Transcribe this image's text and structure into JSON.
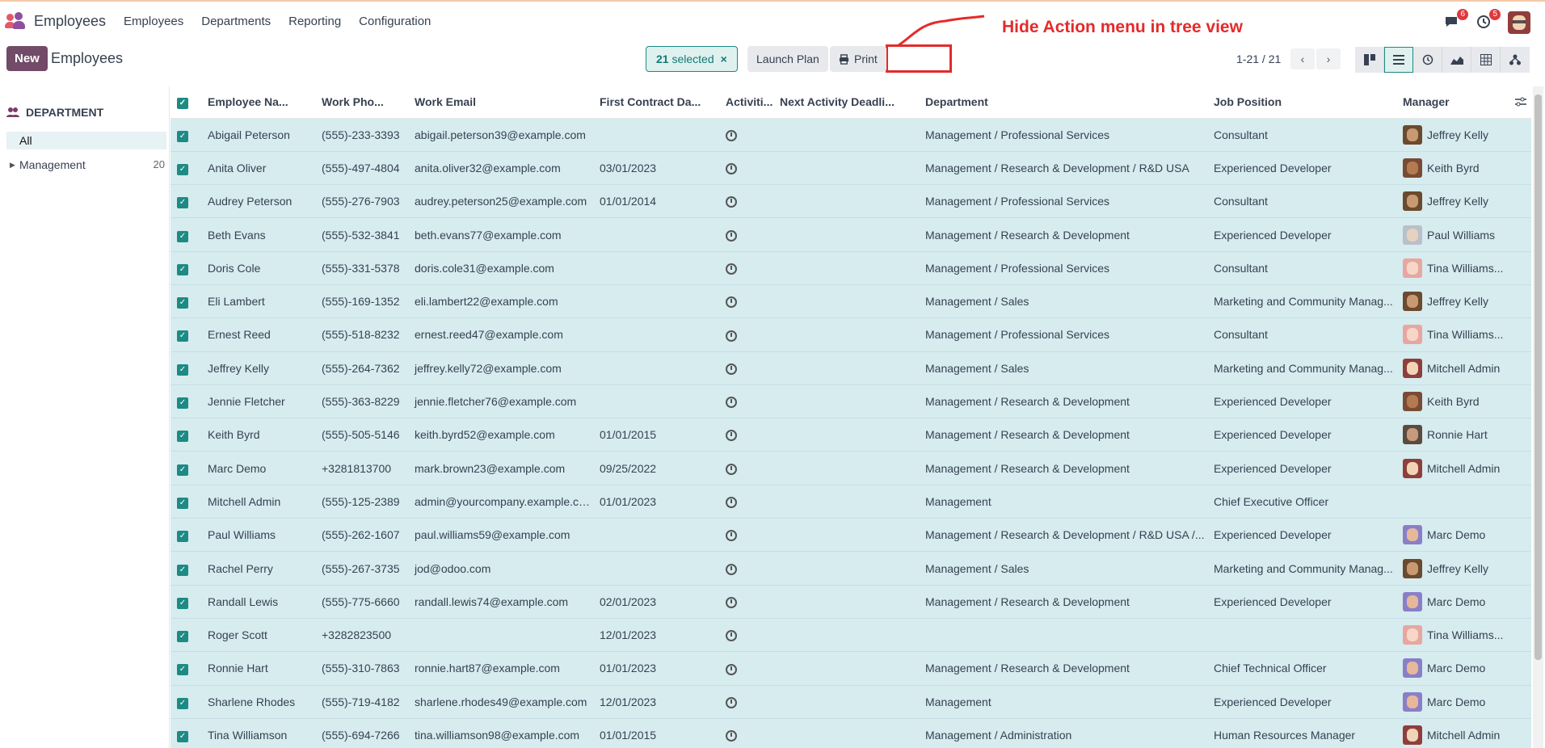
{
  "app": {
    "name": "Employees",
    "menu": [
      "Employees",
      "Departments",
      "Reporting",
      "Configuration"
    ]
  },
  "systray": {
    "messages_count": "6",
    "activities_count": "5"
  },
  "annotation": {
    "text": "Hide Action menu in tree view"
  },
  "control": {
    "new_label": "New",
    "breadcrumb": "Employees",
    "selected_count": "21",
    "selected_label": "selected",
    "launch_plan_label": "Launch Plan",
    "print_label": "Print",
    "pager": "1-21 / 21"
  },
  "sidebar": {
    "title": "DEPARTMENT",
    "all_label": "All",
    "items": [
      {
        "label": "Management",
        "count": "20"
      }
    ]
  },
  "columns": [
    "Employee Na...",
    "Work Pho...",
    "Work Email",
    "First Contract Da...",
    "Activiti...",
    "Next Activity Deadli...",
    "Department",
    "Job Position",
    "Manager"
  ],
  "rows": [
    {
      "name": "Abigail Peterson",
      "phone": "(555)-233-3393",
      "email": "abigail.peterson39@example.com",
      "contract": "",
      "dept": "Management / Professional Services",
      "job": "Consultant",
      "manager": "Jeffrey Kelly"
    },
    {
      "name": "Anita Oliver",
      "phone": "(555)-497-4804",
      "email": "anita.oliver32@example.com",
      "contract": "03/01/2023",
      "dept": "Management / Research & Development / R&D USA",
      "job": "Experienced Developer",
      "manager": "Keith Byrd"
    },
    {
      "name": "Audrey Peterson",
      "phone": "(555)-276-7903",
      "email": "audrey.peterson25@example.com",
      "contract": "01/01/2014",
      "dept": "Management / Professional Services",
      "job": "Consultant",
      "manager": "Jeffrey Kelly"
    },
    {
      "name": "Beth Evans",
      "phone": "(555)-532-3841",
      "email": "beth.evans77@example.com",
      "contract": "",
      "dept": "Management / Research & Development",
      "job": "Experienced Developer",
      "manager": "Paul Williams"
    },
    {
      "name": "Doris Cole",
      "phone": "(555)-331-5378",
      "email": "doris.cole31@example.com",
      "contract": "",
      "dept": "Management / Professional Services",
      "job": "Consultant",
      "manager": "Tina Williams..."
    },
    {
      "name": "Eli Lambert",
      "phone": "(555)-169-1352",
      "email": "eli.lambert22@example.com",
      "contract": "",
      "dept": "Management / Sales",
      "job": "Marketing and Community Manag...",
      "manager": "Jeffrey Kelly"
    },
    {
      "name": "Ernest Reed",
      "phone": "(555)-518-8232",
      "email": "ernest.reed47@example.com",
      "contract": "",
      "dept": "Management / Professional Services",
      "job": "Consultant",
      "manager": "Tina Williams..."
    },
    {
      "name": "Jeffrey Kelly",
      "phone": "(555)-264-7362",
      "email": "jeffrey.kelly72@example.com",
      "contract": "",
      "dept": "Management / Sales",
      "job": "Marketing and Community Manag...",
      "manager": "Mitchell Admin"
    },
    {
      "name": "Jennie Fletcher",
      "phone": "(555)-363-8229",
      "email": "jennie.fletcher76@example.com",
      "contract": "",
      "dept": "Management / Research & Development",
      "job": "Experienced Developer",
      "manager": "Keith Byrd"
    },
    {
      "name": "Keith Byrd",
      "phone": "(555)-505-5146",
      "email": "keith.byrd52@example.com",
      "contract": "01/01/2015",
      "dept": "Management / Research & Development",
      "job": "Experienced Developer",
      "manager": "Ronnie Hart"
    },
    {
      "name": "Marc Demo",
      "phone": "+3281813700",
      "email": "mark.brown23@example.com",
      "contract": "09/25/2022",
      "dept": "Management / Research & Development",
      "job": "Experienced Developer",
      "manager": "Mitchell Admin"
    },
    {
      "name": "Mitchell Admin",
      "phone": "(555)-125-2389",
      "email": "admin@yourcompany.example.co...",
      "contract": "01/01/2023",
      "dept": "Management",
      "job": "Chief Executive Officer",
      "manager": ""
    },
    {
      "name": "Paul Williams",
      "phone": "(555)-262-1607",
      "email": "paul.williams59@example.com",
      "contract": "",
      "dept": "Management / Research & Development / R&D USA /...",
      "job": "Experienced Developer",
      "manager": "Marc Demo"
    },
    {
      "name": "Rachel Perry",
      "phone": "(555)-267-3735",
      "email": "jod@odoo.com",
      "contract": "",
      "dept": "Management / Sales",
      "job": "Marketing and Community Manag...",
      "manager": "Jeffrey Kelly"
    },
    {
      "name": "Randall Lewis",
      "phone": "(555)-775-6660",
      "email": "randall.lewis74@example.com",
      "contract": "02/01/2023",
      "dept": "Management / Research & Development",
      "job": "Experienced Developer",
      "manager": "Marc Demo"
    },
    {
      "name": "Roger Scott",
      "phone": "+3282823500",
      "email": "",
      "contract": "12/01/2023",
      "dept": "",
      "job": "",
      "manager": "Tina Williams..."
    },
    {
      "name": "Ronnie Hart",
      "phone": "(555)-310-7863",
      "email": "ronnie.hart87@example.com",
      "contract": "01/01/2023",
      "dept": "Management / Research & Development",
      "job": "Chief Technical Officer",
      "manager": "Marc Demo"
    },
    {
      "name": "Sharlene Rhodes",
      "phone": "(555)-719-4182",
      "email": "sharlene.rhodes49@example.com",
      "contract": "12/01/2023",
      "dept": "Management",
      "job": "Experienced Developer",
      "manager": "Marc Demo"
    },
    {
      "name": "Tina Williamson",
      "phone": "(555)-694-7266",
      "email": "tina.williamson98@example.com",
      "contract": "01/01/2015",
      "dept": "Management / Administration",
      "job": "Human Resources Manager",
      "manager": "Mitchell Admin"
    }
  ],
  "colors": {
    "accent": "#714b67",
    "selection": "#d6ecef",
    "teal": "#1d8a84",
    "annotation": "#e32b2b"
  }
}
